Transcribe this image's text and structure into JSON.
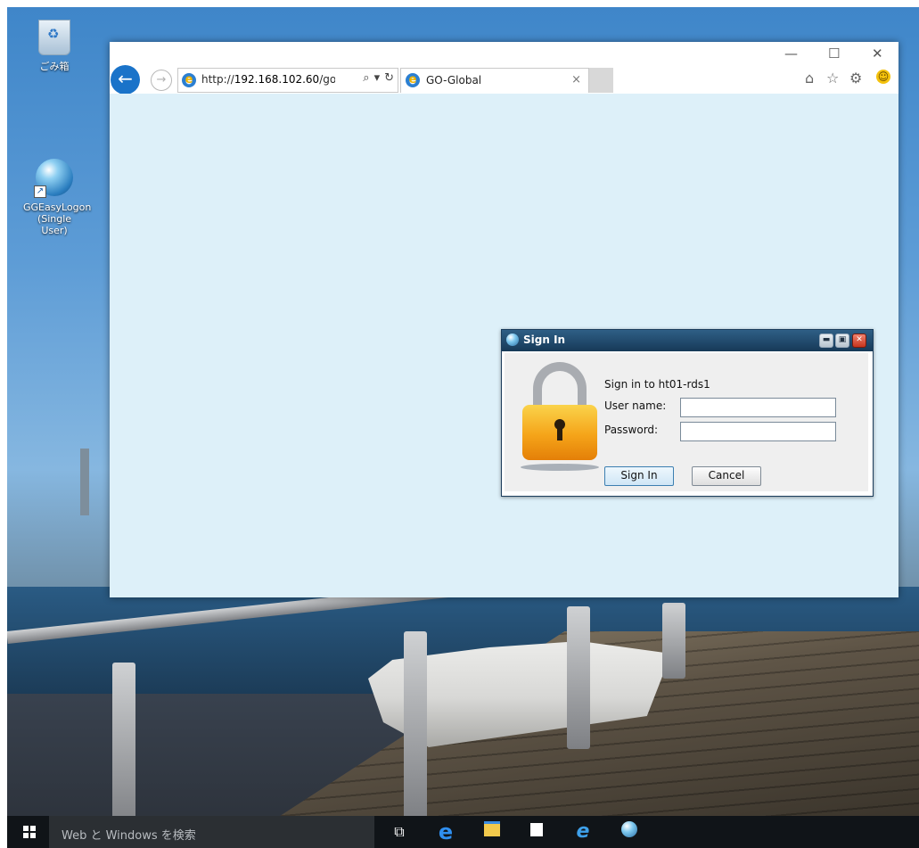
{
  "desktop": {
    "icons": [
      {
        "label": "ごみ箱"
      },
      {
        "label_line1": "GGEasyLogon",
        "label_line2": "(Single User)"
      }
    ]
  },
  "browser": {
    "address": {
      "prefix": "http://",
      "host": "192.168.102.60",
      "path": "/goglob"
    },
    "tab": {
      "title": "GO-Global",
      "close": "×"
    },
    "window_controls": {
      "minimize": "—",
      "maximize": "☐",
      "close": "✕"
    },
    "commands": [
      "home-icon",
      "favorites-icon",
      "settings-icon",
      "feedback-icon"
    ]
  },
  "dialog": {
    "title": "Sign In",
    "heading": "Sign in to ht01-rds1",
    "username_label": "User name:",
    "password_label": "Password:",
    "username_value": "",
    "password_value": "",
    "signin_label": "Sign In",
    "cancel_label": "Cancel"
  },
  "taskbar": {
    "search_placeholder": "Web と Windows を検索",
    "pinned": [
      "task-view-icon",
      "edge-icon",
      "file-explorer-icon",
      "store-icon",
      "ie-icon",
      "go-global-icon"
    ]
  },
  "colors": {
    "browser_background": "#ddf0f9",
    "back_button": "#1a73c9",
    "dialog_titlebar": "#1c3d5c",
    "taskbar": "#101418"
  }
}
